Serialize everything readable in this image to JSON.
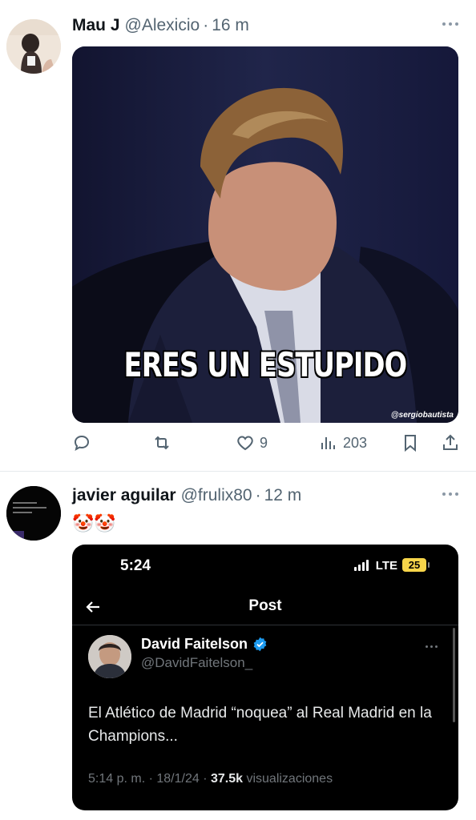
{
  "tweets": [
    {
      "name": "Mau J",
      "handle": "@Alexicio",
      "time": "16 m",
      "media": {
        "caption": "ERES UN ESTUPIDO",
        "watermark": "@sergiobautista"
      },
      "actions": {
        "reply_count": "",
        "retweet_count": "",
        "like_count": "9",
        "views_count": "203"
      }
    },
    {
      "name": "javier aguilar",
      "handle": "@frulix80",
      "time": "12 m",
      "text": "🤡🤡",
      "embedded": {
        "status_time": "5:24",
        "network": "LTE",
        "battery": "25",
        "nav_title": "Post",
        "author_name": "David Faitelson",
        "author_handle": "@DavidFaitelson_",
        "body": "El Atlético de Madrid “noquea” al Real Madrid en la Champions...",
        "meta_time": "5:14 p. m. · 18/1/24 · ",
        "meta_views": "37.5k",
        "meta_views_label": " visualizaciones"
      }
    }
  ],
  "separator": "·",
  "colors": {
    "text": "#0f1419",
    "muted": "#536471",
    "verified": "#1d9bf0",
    "battery": "#f7d54a"
  },
  "icons": [
    "reply-icon",
    "retweet-icon",
    "like-icon",
    "views-icon",
    "bookmark-icon",
    "share-icon",
    "more-icon",
    "back-arrow-icon",
    "verified-badge-icon",
    "signal-icon",
    "battery-icon"
  ]
}
